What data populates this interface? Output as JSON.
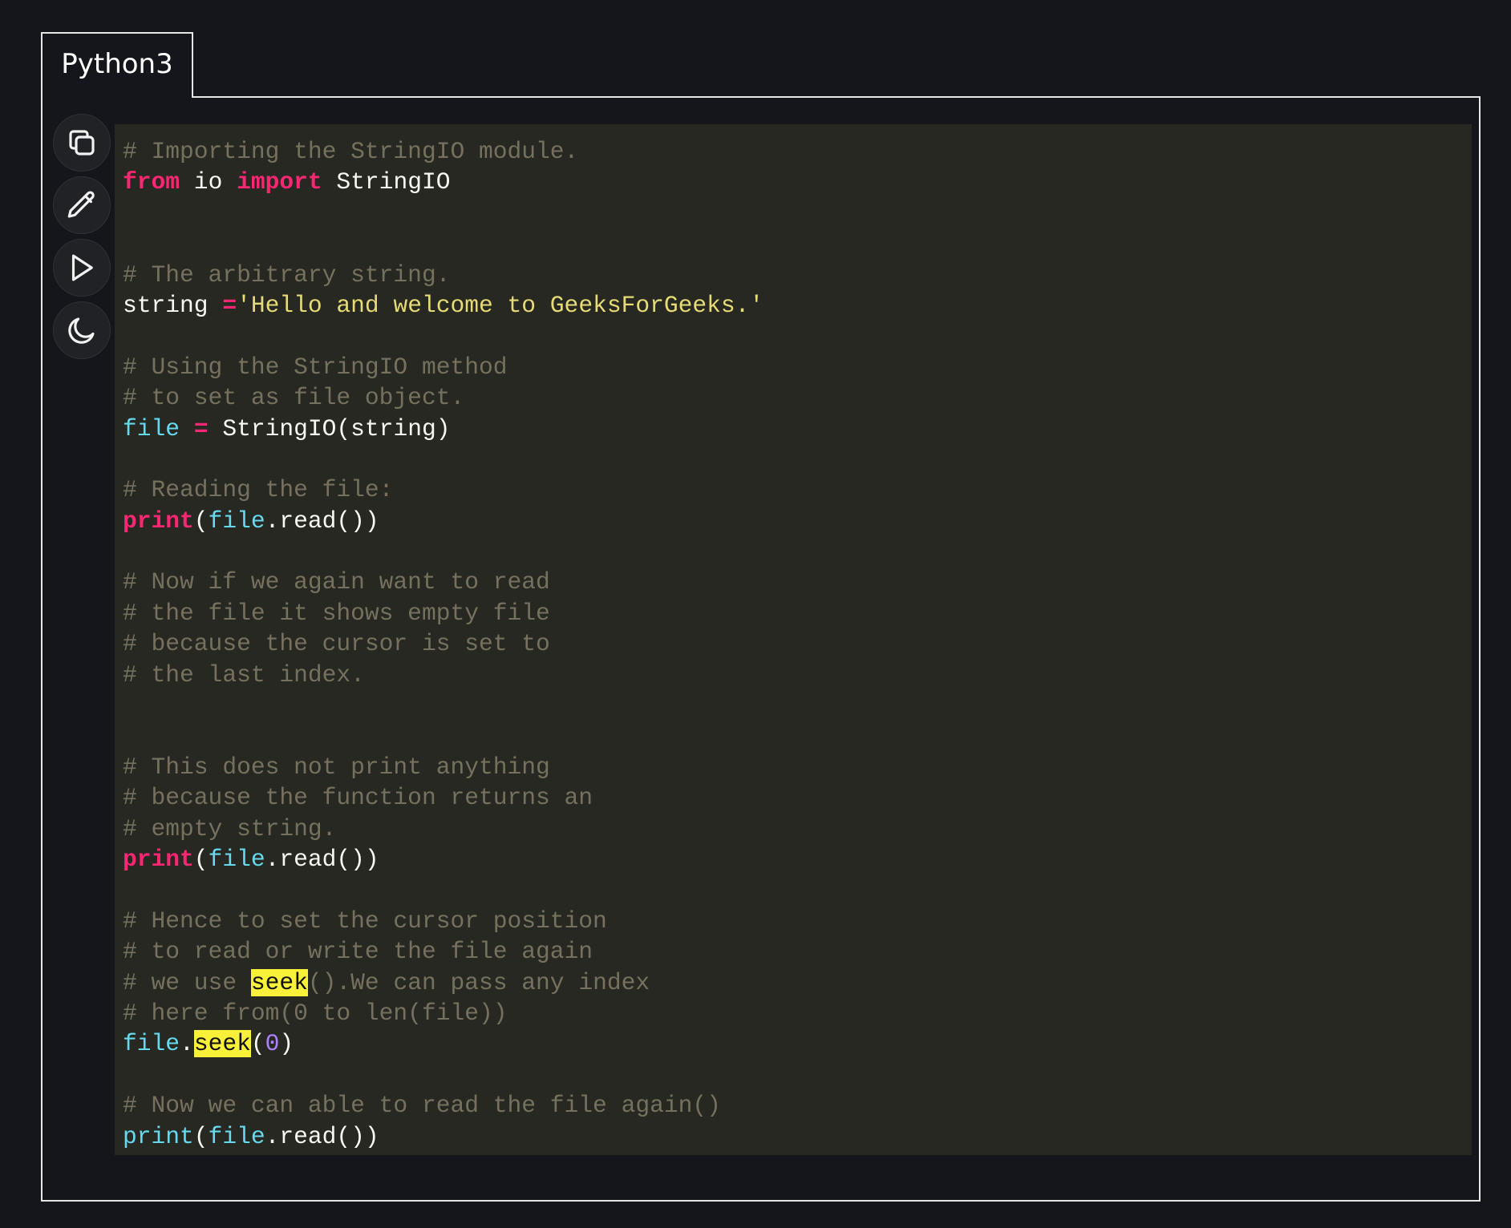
{
  "tab": {
    "label": "Python3"
  },
  "toolbar": {
    "buttons": [
      {
        "name": "copy-button",
        "icon": "copy-icon"
      },
      {
        "name": "edit-button",
        "icon": "pencil-icon"
      },
      {
        "name": "run-button",
        "icon": "play-icon"
      },
      {
        "name": "theme-toggle-button",
        "icon": "moon-icon"
      }
    ]
  },
  "colors": {
    "page_background": "#14161b",
    "code_background": "#272822",
    "comment": "#75715e",
    "keyword": "#f92672",
    "string": "#e6db74",
    "variable": "#66d9ef",
    "number": "#ae81ff",
    "plain": "#f8f8f2",
    "highlight": "#f9f03a"
  },
  "code": {
    "language": "python",
    "lines": [
      [
        {
          "t": "c",
          "v": "# Importing the StringIO module."
        }
      ],
      [
        {
          "t": "k",
          "v": "from"
        },
        {
          "t": "p",
          "v": " io "
        },
        {
          "t": "k",
          "v": "import"
        },
        {
          "t": "p",
          "v": " StringIO"
        }
      ],
      [],
      [],
      [
        {
          "t": "c",
          "v": "# The arbitrary string."
        }
      ],
      [
        {
          "t": "p",
          "v": "string "
        },
        {
          "t": "o",
          "v": "="
        },
        {
          "t": "s",
          "v": "'Hello and welcome to GeeksForGeeks.'"
        }
      ],
      [],
      [
        {
          "t": "c",
          "v": "# Using the StringIO method"
        }
      ],
      [
        {
          "t": "c",
          "v": "# to set as file object."
        }
      ],
      [
        {
          "t": "v",
          "v": "file"
        },
        {
          "t": "p",
          "v": " "
        },
        {
          "t": "o",
          "v": "="
        },
        {
          "t": "p",
          "v": " StringIO(string)"
        }
      ],
      [],
      [
        {
          "t": "c",
          "v": "# Reading the file:"
        }
      ],
      [
        {
          "t": "k",
          "v": "print"
        },
        {
          "t": "p",
          "v": "("
        },
        {
          "t": "v",
          "v": "file"
        },
        {
          "t": "p",
          "v": ".read())"
        }
      ],
      [],
      [
        {
          "t": "c",
          "v": "# Now if we again want to read"
        }
      ],
      [
        {
          "t": "c",
          "v": "# the file it shows empty file"
        }
      ],
      [
        {
          "t": "c",
          "v": "# because the cursor is set to"
        }
      ],
      [
        {
          "t": "c",
          "v": "# the last index."
        }
      ],
      [],
      [],
      [
        {
          "t": "c",
          "v": "# This does not print anything"
        }
      ],
      [
        {
          "t": "c",
          "v": "# because the function returns an"
        }
      ],
      [
        {
          "t": "c",
          "v": "# empty string."
        }
      ],
      [
        {
          "t": "k",
          "v": "print"
        },
        {
          "t": "p",
          "v": "("
        },
        {
          "t": "v",
          "v": "file"
        },
        {
          "t": "p",
          "v": ".read())"
        }
      ],
      [],
      [
        {
          "t": "c",
          "v": "# Hence to set the cursor position"
        }
      ],
      [
        {
          "t": "c",
          "v": "# to read or write the file again"
        }
      ],
      [
        {
          "t": "c",
          "v": "# we use "
        },
        {
          "t": "h",
          "v": "seek"
        },
        {
          "t": "c",
          "v": "().We can pass any index"
        }
      ],
      [
        {
          "t": "c",
          "v": "# here from(0 to len(file))"
        }
      ],
      [
        {
          "t": "v",
          "v": "file"
        },
        {
          "t": "p",
          "v": "."
        },
        {
          "t": "h",
          "v": "seek"
        },
        {
          "t": "p",
          "v": "("
        },
        {
          "t": "n",
          "v": "0"
        },
        {
          "t": "p",
          "v": ")"
        }
      ],
      [],
      [
        {
          "t": "c",
          "v": "# Now we can able to read the file again()"
        }
      ],
      [
        {
          "t": "v",
          "v": "print"
        },
        {
          "t": "p",
          "v": "("
        },
        {
          "t": "v",
          "v": "file"
        },
        {
          "t": "p",
          "v": ".read())"
        }
      ]
    ]
  }
}
